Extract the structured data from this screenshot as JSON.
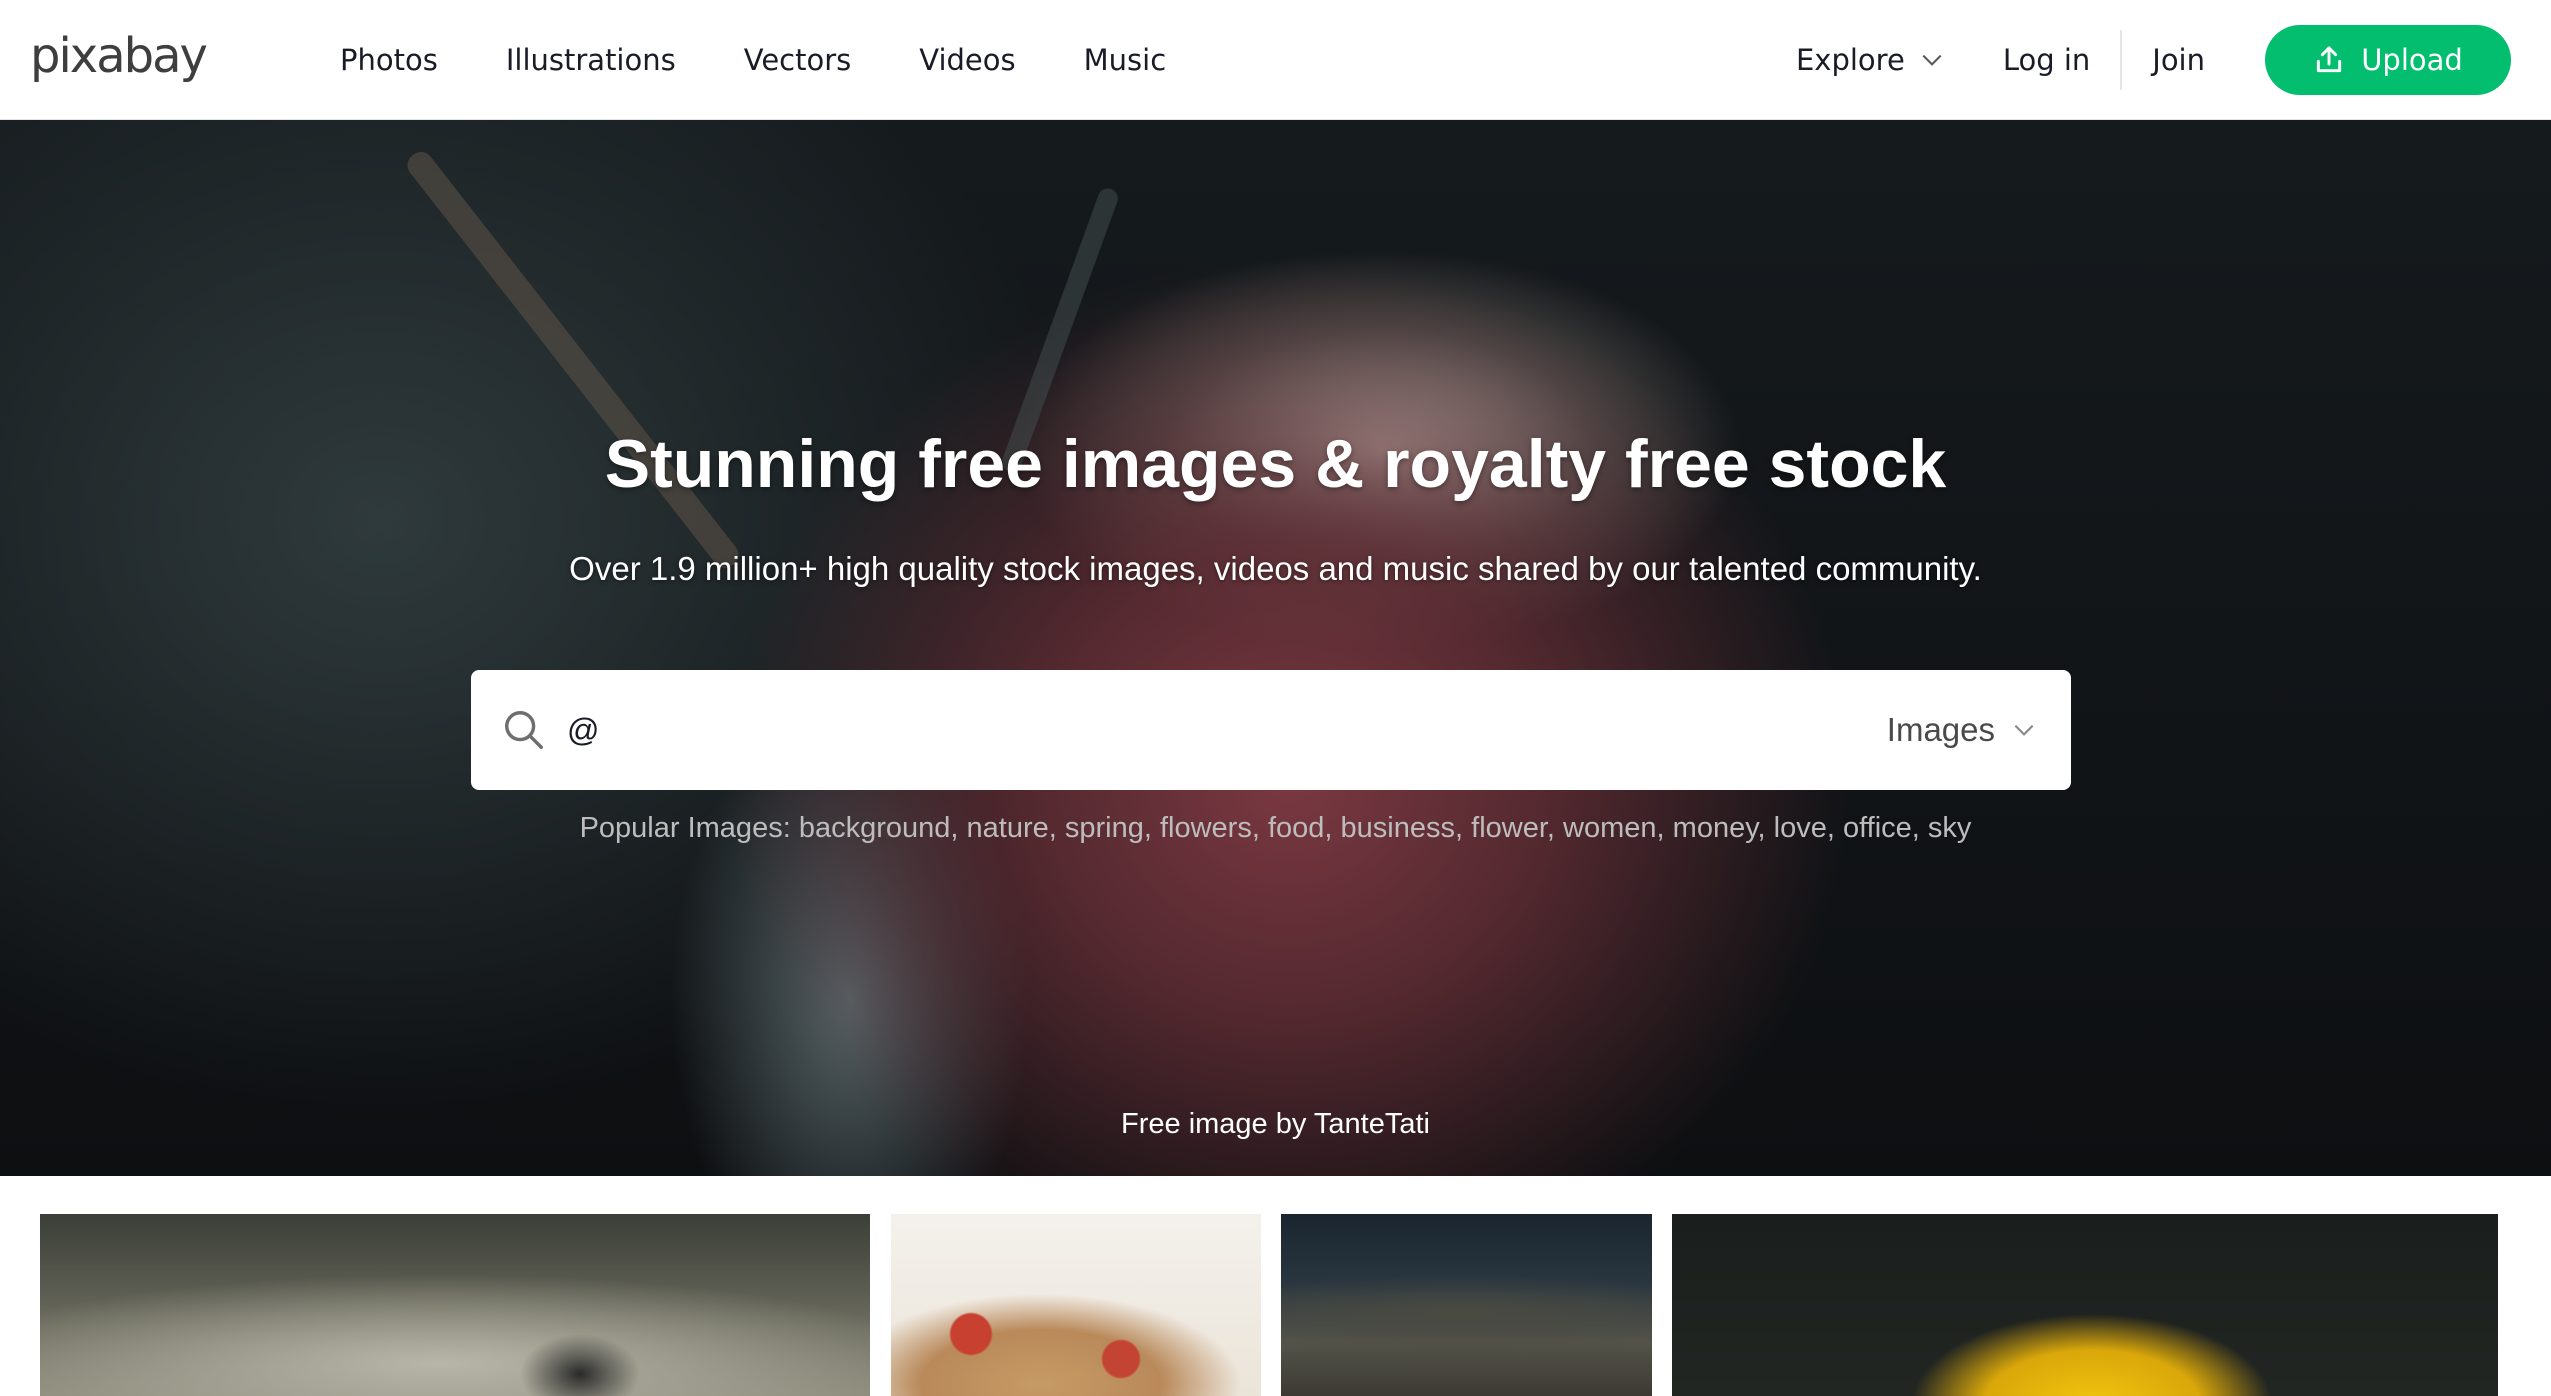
{
  "header": {
    "logo": "pixabay",
    "nav": [
      "Photos",
      "Illustrations",
      "Vectors",
      "Videos",
      "Music"
    ],
    "explore_label": "Explore",
    "login_label": "Log in",
    "join_label": "Join",
    "upload_label": "Upload"
  },
  "hero": {
    "title": "Stunning free images & royalty free stock",
    "subtitle": "Over 1.9 million+ high quality stock images, videos and music shared by our talented community.",
    "search": {
      "value": "@",
      "type_label": "Images"
    },
    "popular_label": "Popular Images:",
    "popular_tags": [
      "background",
      "nature",
      "spring",
      "flowers",
      "food",
      "business",
      "flower",
      "women",
      "money",
      "love",
      "office",
      "sky"
    ],
    "credit": "Free image by TanteTati"
  },
  "colors": {
    "brand_green": "#02be6e",
    "text": "#191b26"
  },
  "icons": {
    "search": "search-icon",
    "chevron": "chevron-down-icon",
    "upload": "upload-icon"
  }
}
